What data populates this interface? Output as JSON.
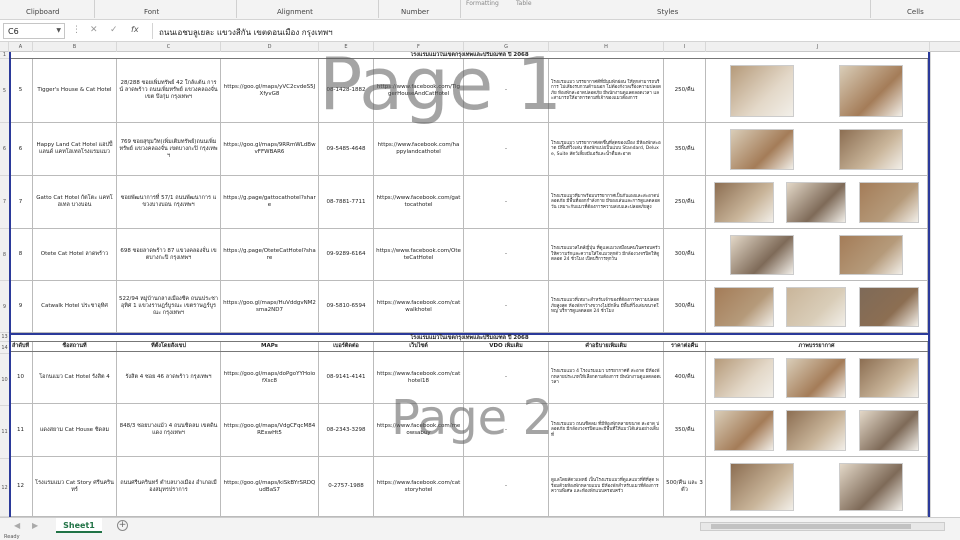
{
  "ribbon": {
    "groups": [
      "Clipboard",
      "Font",
      "Alignment",
      "Number",
      "Styles",
      "Cells"
    ],
    "fragments": [
      "Formatting",
      "Table"
    ]
  },
  "formula_bar": {
    "name_box": "C6",
    "formula": "ถนนเอชบลูเยละ แขวงสีกัน เขตดอนเมือง กรุงเทพฯ"
  },
  "columns": [
    "A",
    "B",
    "C",
    "D",
    "E",
    "F",
    "G",
    "H",
    "I",
    "J"
  ],
  "rows_visible": [
    "1",
    "5",
    "6",
    "7",
    "8",
    "9",
    "13",
    "14",
    "10",
    "11",
    "12"
  ],
  "section1": {
    "title": "โรงแรมแมวในเขตกรุงเทพและปริมณฑล ปี 2068",
    "rows": [
      {
        "rownum": "5",
        "no": "5",
        "name": "Tigger's House & Cat Hotel",
        "address": "28/288 ซอยเพิ่มทรัพย์ 42 ใกล้เเต้น การน์ ลาดพร้าว ถนนเพิ่มทรัพย์ แขวงคลองจั่น เขต บึงกุ่ม กรุงเทพฯ",
        "maps": "https://goo.gl/maps/yVC2cvdeS5JXfyvG8",
        "phone": "08-1428-1882",
        "facebook": "https://www.facebook.com/TiggerHouseAndCatHotel",
        "vdo": "-",
        "desc": "โรงแรมแมว บรรยากาศดีที่มีมุมพักผ่อน ให้ทุกสามารถบริการ ไม่เสียงรบกวนด้านนอก ไม่ต้องกังวลเรื่องความปลอดภัย ห้องพักสะอาดปลอดภัย มีพนักงานดูแลตลอดเวลา และสามารถให้อาหารตามที่เจ้าของแมวต้องการ",
        "price": "250/คืน",
        "photos": 2
      },
      {
        "rownum": "6",
        "no": "6",
        "name": "Happy Land Cat Hotel แฮปปี้แลนด์ แคทโฮเทลโรงแรมแมว",
        "address": "769 ซอยสุขุมวิท(เพิ่มเติมทรัพย์)ถนนเพิ่มทรัพย์ แขวงคลองจั่น เขตบางกะปิ กรุงเทพฯ",
        "maps": "https://goo.gl/maps/9RRmWLdBwvFFWBAR6",
        "phone": "09-5485-4648",
        "facebook": "https://www.facebook.com/happylandcathotel",
        "vdo": "-",
        "desc": "โรงแรมแมว บรรยากาศสดชื่นที่สุดของเมือง มีห้องพักสะอาด มีพื้นที่วิ่งเล่น ห้องพักแบ่งเป็นแบบ Standard, Deluxe, Suite สัตว์เลี้ยงมีแอร์และน้ำดื่มสะอาด",
        "price": "350/คืน",
        "photos": 2
      },
      {
        "rownum": "7",
        "no": "7",
        "name": "Gatto Cat Hotel กัตโตะ แคทโฮเทล บางบอน",
        "address": "ซอยพัฒนาการที่ 57/1 ถนนพัฒนาการ แขวงบางบอน กรุงเทพฯ",
        "maps": "https://g.page/gattocathotel?share",
        "phone": "08-7881-7711",
        "facebook": "https://www.facebook.com/gattocathotel",
        "vdo": "-",
        "desc": "โรงแรมแมวทีมาพร้อมบรรยากาศเป็นกันเองและสะอาดปลอดภัย มีพื้นที่ออกกำลังกาย มีของเล่นและการดูแลตลอดวัน เหมาะกับแมวที่ต้องการความสงบและปลอดภัยสูง",
        "price": "250/คืน",
        "photos": 3
      },
      {
        "rownum": "8",
        "no": "8",
        "name": "Otete Cat Hotel ลาดพร้าว",
        "address": "698 ซอยลาดพร้าว 87 แขวงคลองจั่น เขตบางกะปิ กรุงเทพฯ",
        "maps": "https://g.page/OteteCatHotel?share",
        "phone": "09-9289-6164",
        "facebook": "https://www.facebook.com/OteteCatHotel",
        "vdo": "-",
        "desc": "โรงแรมแมวสไตล์ญี่ปุ่น ที่ดูแลแมวเหมือนคนในครอบครัว ให้ความรักและความใส่ใจแมวทุกตัว มีกล้องวงจรปิดให้ดูตลอด 24 ชั่วโมง เปิดบริการทุกวัน",
        "price": "300/คืน",
        "photos": 2
      },
      {
        "rownum": "9",
        "no": "9",
        "name": "Catwalk Hotel ประชาอุทิศ",
        "address": "522/94 หมู่บ้านกลางเมืองชีค ถนนประชาอุทิศ 1 แขวงราษฎร์บูรณะ เขตราษฎร์บูรณะ กรุงเทพฯ",
        "maps": "https://goo.gl/maps/HuVddgvNM2sma2ND7",
        "phone": "09-5810-6594",
        "facebook": "https://www.facebook.com/catwalkhotel",
        "vdo": "-",
        "desc": "โรงแรมแมวที่เหมาะสำหรับเจ้าของที่ต้องการความปลอดภัยสูงสุด ห้องพักกว้างขวางไม่มีกลิ่น มีพื้นที่วิ่งเล่นขนาดใหญ่ บริการดูแลตลอด 24 ชั่วโมง",
        "price": "300/คืน",
        "photos": 3
      }
    ]
  },
  "section2": {
    "title": "โรงแรมแมวในเขตกรุงเทพและปริมณฑล ปี 2068",
    "headers": [
      "ลำดับที่",
      "ชื่อสถานที่",
      "ที่ตั้งโดยสังเขป",
      "MAPs",
      "เบอร์ติดต่อ",
      "เว็บไซต์",
      "VDO เพิ่มเติม",
      "คำอธิบายเพิ่มเติม",
      "ราคาต่อคืน",
      "ภาพบรรยากาศ"
    ],
    "rows": [
      {
        "rownum": "10",
        "no": "10",
        "name": "โอกนแมว Cat Hotel รังสิต 4",
        "address": "รังสิต 4 ซอย 46 ลาดพร้าว กรุงเทพฯ",
        "maps": "https://goo.gl/maps/doPgoYYHoiofXsc8",
        "phone": "08-9141-4141",
        "facebook": "https://www.facebook.com/cathotel18",
        "vdo": "-",
        "desc": "โรงแรมแมว 4 โรงแรมแมว บรรยากาศดี สะอาด มีห้องพักหลายประเภทให้เลือกตามต้องการ มีพนักงานดูแลตลอดเวลา",
        "price": "400/คืน",
        "photos": 3
      },
      {
        "rownum": "11",
        "no": "11",
        "name": "แดงสยาม Cat House ชิดลม",
        "address": "848/3 ซอยบางแม้ว 4 ถนนชิดลม เขตดินแดง กรุงเทพฯ",
        "maps": "https://goo.gl/maps/VdgCFqcM84RExwHt5",
        "phone": "08-2343-3298",
        "facebook": "https://www.facebook.com/meowsabuy",
        "vdo": "-",
        "desc": "โรงแรมแมว ถนนชิดลม ที่มีห้องพักหลายขนาด สะอาด ปลอดภัย มีกล้องวงจรปิดและมีพื้นที่ให้แมวได้เล่นอย่างเต็มที่",
        "price": "350/คืน",
        "photos": 3
      },
      {
        "rownum": "12",
        "no": "12",
        "name": "โรงแรมแมว Cat Story ศรีนครินทร์",
        "address": "ถนนศรีนครินทร์ ตำบลบางเมือง อำเภอเมืองสมุทรปราการ",
        "maps": "https://goo.gl/maps/kiSkBYrSRDQudBaS7",
        "phone": "0-2757-1988",
        "facebook": "https://www.facebook.com/catstoryhotel",
        "vdo": "-",
        "desc": "ดูแลโดยสัตวแพทย์ เป็นโรงแรมแมวที่ดูแลแมวที่ดีที่สุด พร้อมด้วยห้องพักหลายแบบ มีห้องพักสำหรับแมวที่ต้องการความพิเศษ และห้องพักแบบครอบครัว",
        "price": "500/คืน และ 3 ตัว",
        "photos": 2
      }
    ]
  },
  "watermarks": [
    "Page 1",
    "Page 2"
  ],
  "tabs": {
    "sheet": "Sheet1",
    "add": "+"
  },
  "status": "Ready"
}
